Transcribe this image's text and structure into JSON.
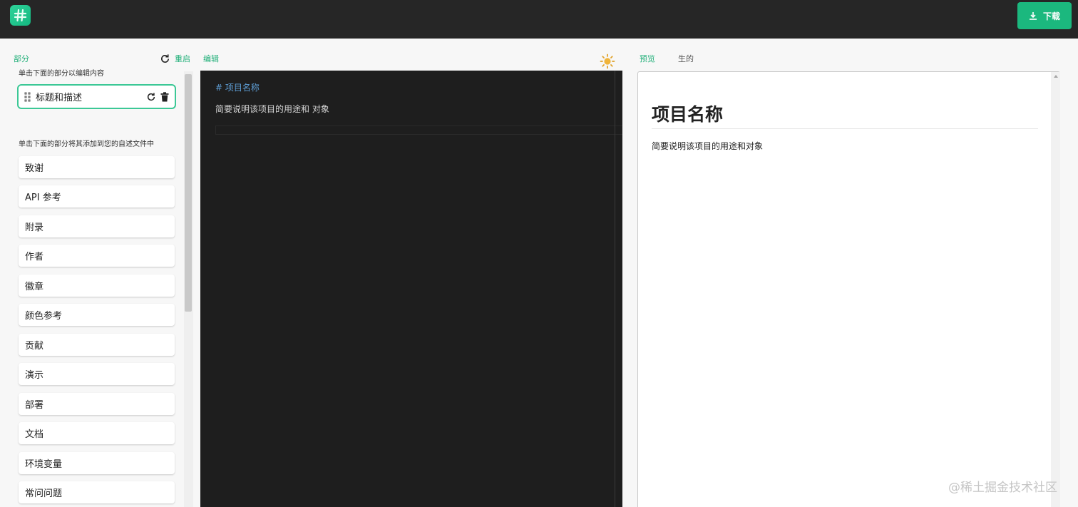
{
  "app": {
    "logo_icon": "hash-icon",
    "download_label": "下载",
    "accent_color": "#1bb87e"
  },
  "sidebar": {
    "title": "部分",
    "reset_label": "重启",
    "edit_hint": "单击下面的部分以编辑内容",
    "selected_section": "标题和描述",
    "add_hint": "单击下面的部分将其添加到您的自述文件中",
    "items": [
      "致谢",
      "API 参考",
      "附录",
      "作者",
      "徽章",
      "颜色参考",
      "贡献",
      "演示",
      "部署",
      "文档",
      "环境变量",
      "常问问题"
    ]
  },
  "editor": {
    "title": "编辑",
    "line1": "#  项目名称",
    "line2": "简要说明该项目的用途和  对象",
    "theme_icon": "sun-icon"
  },
  "preview": {
    "tab_preview": "预览",
    "tab_raw": "生的",
    "heading": "项目名称",
    "body": "简要说明该项目的用途和对象"
  },
  "watermark": "@稀土掘金技术社区"
}
